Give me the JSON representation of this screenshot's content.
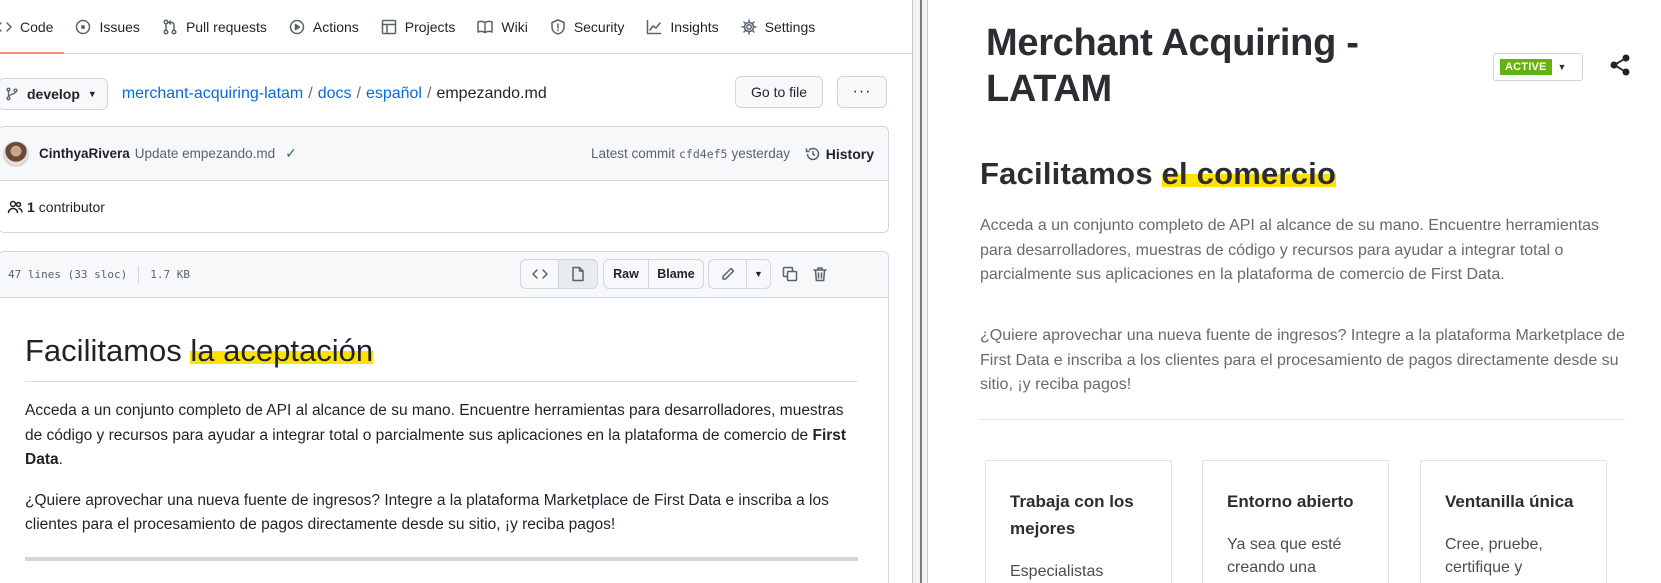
{
  "github": {
    "tabs": [
      {
        "label": "Code"
      },
      {
        "label": "Issues"
      },
      {
        "label": "Pull requests"
      },
      {
        "label": "Actions"
      },
      {
        "label": "Projects"
      },
      {
        "label": "Wiki"
      },
      {
        "label": "Security"
      },
      {
        "label": "Insights"
      },
      {
        "label": "Settings"
      }
    ],
    "branch": "develop",
    "breadcrumb": {
      "repo": "merchant-acquiring-latam",
      "dir1": "docs",
      "dir2": "español",
      "file": "empezando.md",
      "sep": "/"
    },
    "go_to_file": "Go to file",
    "more": "···",
    "commit": {
      "author": "CinthyaRivera",
      "message": "Update empezando.md",
      "latest_label": "Latest commit",
      "sha": "cfd4ef5",
      "when": "yesterday",
      "history": "History"
    },
    "contributors": {
      "count": "1",
      "label": "contributor"
    },
    "file_info": {
      "lines": "47 lines (33 sloc)",
      "size": "1.7 KB"
    },
    "file_buttons": {
      "raw": "Raw",
      "blame": "Blame"
    },
    "readme": {
      "title_plain": "Facilitamos ",
      "title_highlight": "la aceptación",
      "p1_start": "Acceda a un conjunto completo de API al alcance de su mano. Encuentre herramientas para desarrolladores, muestras de código y recursos para ayudar a integrar total o parcialmente sus aplicaciones en la plataforma de comercio de ",
      "p1_bold": "First Data",
      "p1_end": ".",
      "p2": "¿Quiere aprovechar una nueva fuente de ingresos? Integre a la plataforma Marketplace de First Data e inscriba a los clientes para el procesamiento de pagos directamente desde su sitio, ¡y reciba pagos!"
    }
  },
  "preview": {
    "title": "Merchant Acquiring - LATAM",
    "status": "ACTIVE",
    "heading_plain": "Facilitamos ",
    "heading_highlight": "el comercio",
    "p1": "Acceda a un conjunto completo de API al alcance de su mano. Encuentre herramientas para desarrolladores, muestras de código y recursos para ayudar a integrar total o parcialmente sus aplicaciones en la plataforma de comercio de First Data.",
    "p2": "¿Quiere aprovechar una nueva fuente de ingresos? Integre a la plataforma Marketplace de First Data e inscriba a los clientes para el procesamiento de pagos directamente desde su sitio, ¡y reciba pagos!",
    "cards": [
      {
        "title": "Trabaja con los mejores",
        "text": "Especialistas"
      },
      {
        "title": "Entorno abierto",
        "text": "Ya sea que esté creando una"
      },
      {
        "title": "Ventanilla única",
        "text": "Cree, pruebe, certifique y"
      }
    ]
  },
  "colors": {
    "link": "#0969da",
    "tab_underline": "#fd8c73",
    "highlight": "#ffe200",
    "status_badge": "#62b30f",
    "check": "#1a7f37"
  },
  "icons": [
    "code-icon",
    "issues-icon",
    "pull-request-icon",
    "actions-icon",
    "projects-icon",
    "wiki-icon",
    "security-icon",
    "insights-icon",
    "settings-icon",
    "branch-icon",
    "check-icon",
    "history-icon",
    "people-icon",
    "pencil-icon",
    "copy-icon",
    "trash-icon",
    "share-icon"
  ]
}
